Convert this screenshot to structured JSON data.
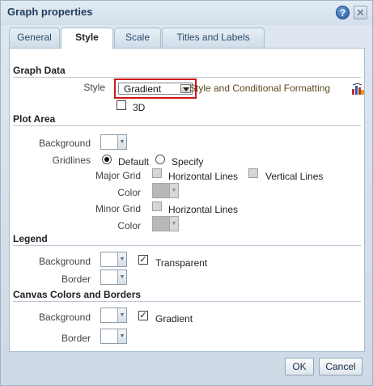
{
  "dialog": {
    "title": "Graph properties",
    "help_icon_glyph": "?",
    "close_icon_glyph": "✕"
  },
  "tabs": [
    {
      "label": "General",
      "active": false
    },
    {
      "label": "Style",
      "active": true
    },
    {
      "label": "Scale",
      "active": false
    },
    {
      "label": "Titles and Labels",
      "active": false
    }
  ],
  "graph_data": {
    "header": "Graph Data",
    "style_label": "Style",
    "style_value": "Gradient",
    "style_link": "Style and Conditional Formatting",
    "threed_label": "3D",
    "threed_checked": false
  },
  "plot_area": {
    "header": "Plot Area",
    "background_label": "Background",
    "gridlines_label": "Gridlines",
    "default_label": "Default",
    "specify_label": "Specify",
    "gridlines_selected": "Default",
    "major_grid_label": "Major Grid",
    "major_horizontal_label": "Horizontal Lines",
    "major_vertical_label": "Vertical Lines",
    "major_color_label": "Color",
    "minor_grid_label": "Minor Grid",
    "minor_horizontal_label": "Horizontal Lines",
    "minor_color_label": "Color"
  },
  "legend": {
    "header": "Legend",
    "background_label": "Background",
    "transparent_label": "Transparent",
    "transparent_checked": true,
    "border_label": "Border"
  },
  "canvas": {
    "header": "Canvas Colors and Borders",
    "background_label": "Background",
    "gradient_label": "Gradient",
    "gradient_checked": true,
    "border_label": "Border"
  },
  "buttons": {
    "ok": "OK",
    "cancel": "Cancel"
  },
  "check_glyph": "✓",
  "colors": {
    "highlight_border": "#d01818",
    "link_text": "#5b4a1f",
    "disabled_swatch": "#b8b8b8"
  }
}
